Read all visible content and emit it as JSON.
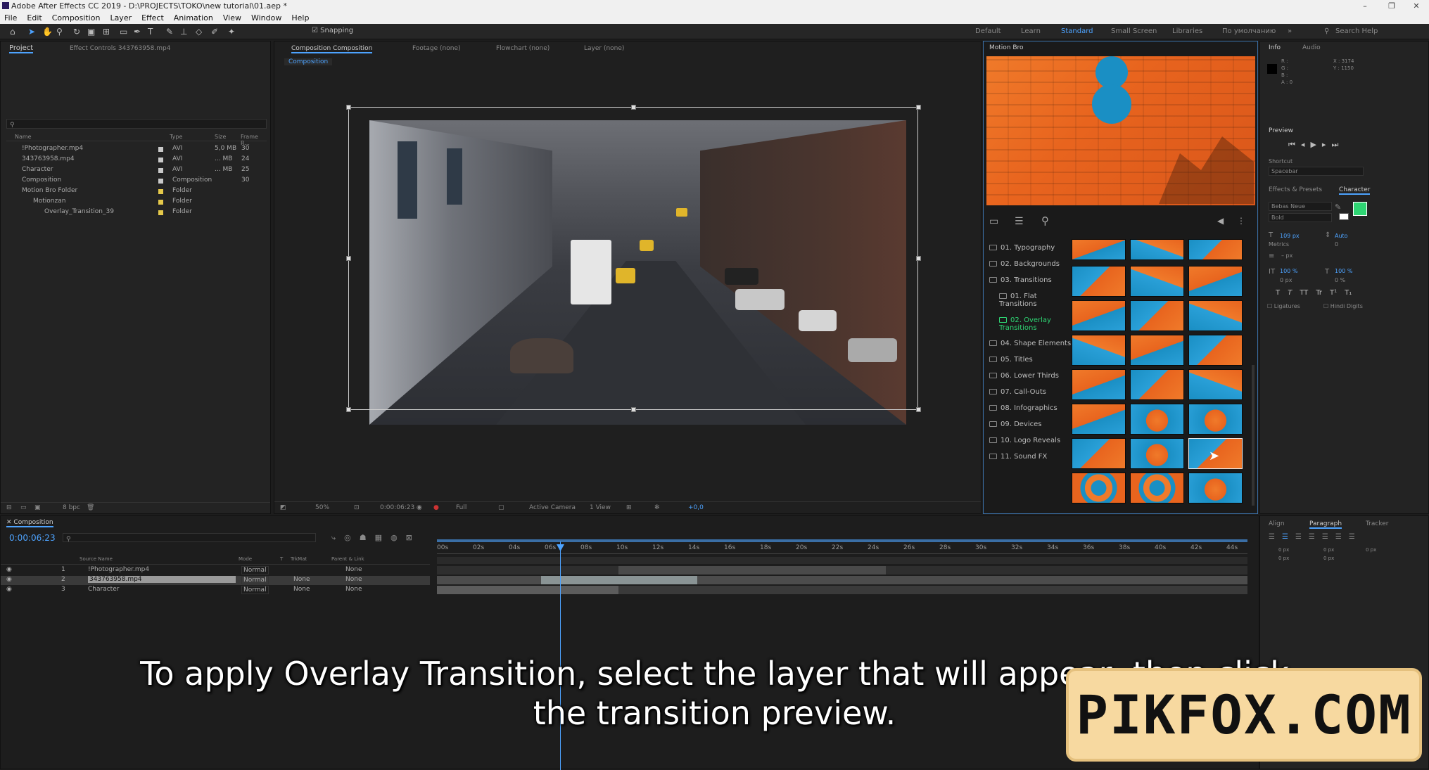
{
  "window": {
    "title": "Adobe After Effects CC 2019 - D:\\PROJECTS\\TOKO\\new tutorial\\01.aep *",
    "min": "–",
    "max": "❐",
    "close": "✕"
  },
  "menu": [
    "File",
    "Edit",
    "Composition",
    "Layer",
    "Effect",
    "Animation",
    "View",
    "Window",
    "Help"
  ],
  "toolbar": {
    "snapping": "Snapping",
    "workspaces": [
      "Default",
      "Learn",
      "Standard",
      "Small Screen",
      "Libraries",
      "По умолчанию"
    ],
    "active_workspace": "Standard",
    "search_help": "Search Help"
  },
  "project": {
    "tab": "Project",
    "effect_controls": "Effect Controls 343763958.mp4",
    "columns": [
      "Name",
      "Type",
      "Size",
      "Frame R..."
    ],
    "items": [
      {
        "name": "!Photographer.mp4",
        "type": "AVI",
        "size": "5,0 MB",
        "fr": "30",
        "color": "#c9c9c9"
      },
      {
        "name": "343763958.mp4",
        "type": "AVI",
        "size": "... MB",
        "fr": "24",
        "color": "#c9c9c9"
      },
      {
        "name": "Character",
        "type": "AVI",
        "size": "... MB",
        "fr": "25",
        "color": "#c9c9c9"
      },
      {
        "name": "Composition",
        "type": "Composition",
        "size": "",
        "fr": "30",
        "color": "#c9c9c9"
      },
      {
        "name": "Motion Bro Folder",
        "type": "Folder",
        "size": "",
        "fr": "",
        "color": "#e5c94a"
      },
      {
        "name": "Motionzan",
        "type": "Folder",
        "size": "",
        "fr": "",
        "color": "#e5c94a"
      },
      {
        "name": "Overlay_Transition_39",
        "type": "Folder",
        "size": "",
        "fr": "",
        "color": "#e5c94a"
      }
    ],
    "bpc": "8 bpc"
  },
  "viewer": {
    "tabs": [
      "Composition Composition",
      "Footage (none)",
      "Flowchart (none)",
      "Layer (none)"
    ],
    "active_tab": "Composition Composition",
    "breadcrumb": "Composition",
    "zoom": "50%",
    "time": "0:00:06:23",
    "resolution": "Full",
    "camera": "Active Camera",
    "views": "1 View",
    "exposure": "+0,0"
  },
  "motionbro": {
    "title": "Motion Bro",
    "categories": [
      "01. Typography",
      "02. Backgrounds",
      "03. Transitions",
      "01. Flat Transitions",
      "02. Overlay Transitions",
      "04. Shape Elements",
      "05. Titles",
      "06. Lower Thirds",
      "07. Call-Outs",
      "08. Infographics",
      "09. Devices",
      "10. Logo Reveals",
      "11. Sound FX"
    ],
    "selected_category": "02. Overlay Transitions"
  },
  "info_panel": {
    "tabs": [
      "Info",
      "Audio"
    ],
    "rgba": [
      "R :",
      "G :",
      "B :",
      "A : 0"
    ],
    "x": "X : 3174",
    "y": "Y : 1150"
  },
  "preview": {
    "title": "Preview",
    "shortcut_label": "Shortcut",
    "shortcut": "Spacebar"
  },
  "character": {
    "tabs": [
      "Effects & Presets",
      "Character"
    ],
    "active_tab": "Character",
    "font": "Bebas Neue",
    "style": "Bold",
    "size": "109 px",
    "leading": "Auto",
    "tracking": "0",
    "kerning": "Metrics",
    "stroke": "– px",
    "vscale": "100 %",
    "hscale": "100 %",
    "baseline": "0 px",
    "tsume": "0 %",
    "styles": [
      "T",
      "T",
      "TT",
      "Tr",
      "T¹",
      "T₁"
    ],
    "ligatures": "Ligatures",
    "hindi": "Hindi Digits",
    "fill_color": "#2ed573"
  },
  "timeline": {
    "tab": "Composition",
    "timecode": "0:00:06:23",
    "columns": [
      "Source Name",
      "Mode",
      "T",
      "TrkMat",
      "Parent & Link"
    ],
    "layers": [
      {
        "num": "1",
        "name": "!Photographer.mp4",
        "mode": "Normal",
        "trkmat": "",
        "parent": "None"
      },
      {
        "num": "2",
        "name": "343763958.mp4",
        "mode": "Normal",
        "trkmat": "None",
        "parent": "None"
      },
      {
        "num": "3",
        "name": "Character",
        "mode": "Normal",
        "trkmat": "None",
        "parent": "None"
      }
    ],
    "ruler": [
      "00s",
      "02s",
      "04s",
      "06s",
      "08s",
      "10s",
      "12s",
      "14s",
      "16s",
      "18s",
      "20s",
      "22s",
      "24s",
      "26s",
      "28s",
      "30s",
      "32s",
      "34s",
      "36s",
      "38s",
      "40s",
      "42s",
      "44s"
    ]
  },
  "align_panel": {
    "tabs": [
      "Align",
      "Paragraph",
      "Tracker"
    ],
    "active_tab": "Paragraph",
    "values": [
      "0 px",
      "0 px",
      "0 px",
      "0 px",
      "0 px"
    ]
  },
  "subtitle": {
    "line1": "To apply Overlay Transition, select the layer that will appear, then click",
    "line2": "the transition preview."
  },
  "watermark": "PIKFOX.COM"
}
